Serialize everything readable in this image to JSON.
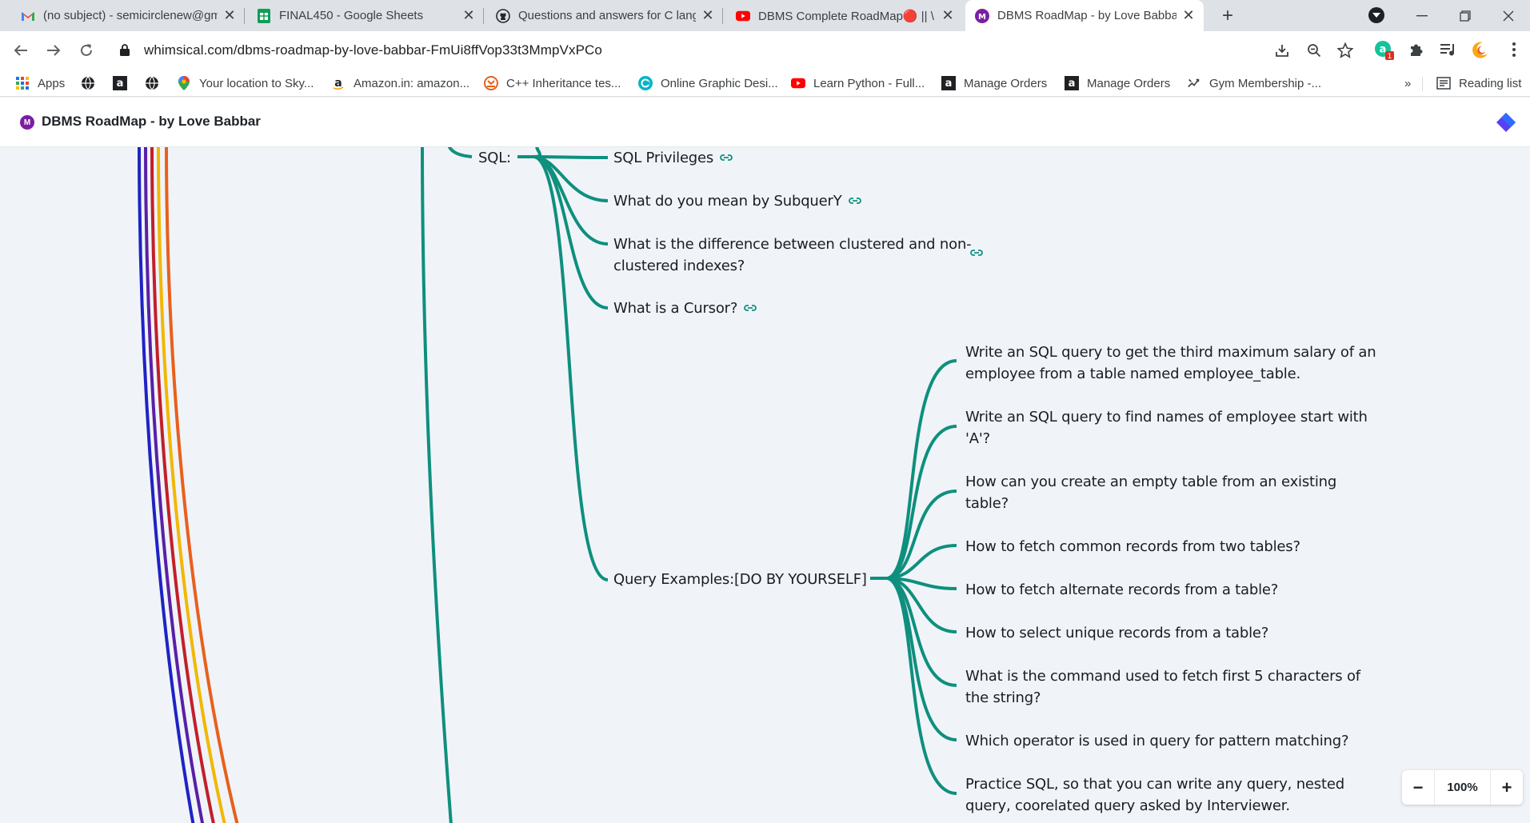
{
  "browser": {
    "tabs": [
      {
        "title": "(no subject) - semicirclenew@gm",
        "icon": "gmail-icon",
        "active": false
      },
      {
        "title": "FINAL450 - Google Sheets",
        "icon": "sheets-icon",
        "active": false
      },
      {
        "title": "Questions and answers for C lang",
        "icon": "github-icon",
        "active": false
      },
      {
        "title": "DBMS Complete RoadMap🔴 || \\",
        "icon": "youtube-icon",
        "active": false
      },
      {
        "title": "DBMS RoadMap - by Love Babba",
        "icon": "whimsical-icon",
        "active": true
      }
    ],
    "url": "whimsical.com/dbms-roadmap-by-love-babbar-FmUi8ffVop33t3MmpVxPCo",
    "extension_badge": "1",
    "bookmarks": [
      {
        "label": "Apps",
        "icon": "apps-grid-icon"
      },
      {
        "label": "",
        "icon": "globe-icon"
      },
      {
        "label": "",
        "icon": "amazon-icon"
      },
      {
        "label": "",
        "icon": "globe-icon"
      },
      {
        "label": "Your location to Sky...",
        "icon": "maps-pin-icon"
      },
      {
        "label": "Amazon.in: amazon...",
        "icon": "amazon-icon"
      },
      {
        "label": "C++ Inheritance tes...",
        "icon": "quiz-icon"
      },
      {
        "label": "Online Graphic Desi...",
        "icon": "canva-icon"
      },
      {
        "label": "Learn Python - Full...",
        "icon": "youtube-icon"
      },
      {
        "label": "Manage Orders",
        "icon": "amazon-icon"
      },
      {
        "label": "Manage Orders",
        "icon": "amazon-icon"
      },
      {
        "label": "Gym Membership -...",
        "icon": "gym-icon"
      }
    ],
    "bookmarks_overflow": "»",
    "reading_list": "Reading list"
  },
  "app": {
    "logo_letter": "M",
    "title": "DBMS RoadMap - by Love Babbar"
  },
  "mindmap": {
    "sql_label": "SQL:",
    "sql_children": [
      {
        "text": "SQL Privileges",
        "link": true
      },
      {
        "text": "What do you mean by SubquerY",
        "link": true
      },
      {
        "text": "What is the difference between clustered and non-clustered indexes?",
        "line1": "What is the difference between clustered and non-",
        "line2": "clustered indexes?",
        "link": true
      },
      {
        "text": "What is a Cursor?",
        "link": true
      }
    ],
    "query_label": "Query Examples:[DO BY YOURSELF]",
    "query_children": [
      {
        "line1": "Write an SQL query to get the third maximum salary of an",
        "line2": "employee from a table named employee_table."
      },
      {
        "line1": "Write an SQL query to find names of employee start with",
        "line2": "'A'?"
      },
      {
        "line1": "How can you create an empty table from an existing",
        "line2": "table?"
      },
      {
        "line1": "How to fetch common records from two tables?",
        "line2": ""
      },
      {
        "line1": "How to fetch alternate records from a table?",
        "line2": ""
      },
      {
        "line1": "How to select unique records from a table?",
        "line2": ""
      },
      {
        "line1": "What is the command used to fetch first 5 characters of",
        "line2": "the string?"
      },
      {
        "line1": "Which operator is used in query for pattern matching?",
        "line2": ""
      },
      {
        "line1": "Practice SQL, so that you can write any query, nested",
        "line2": "query, coorelated query asked by Interviewer."
      }
    ],
    "branch_color": "#0f8f7e",
    "rainbow_colors": [
      "#1f23c4",
      "#5a1fa6",
      "#c21f2a",
      "#f2b705",
      "#e8601c"
    ]
  },
  "zoom": {
    "minus": "−",
    "value": "100%",
    "plus": "+"
  }
}
